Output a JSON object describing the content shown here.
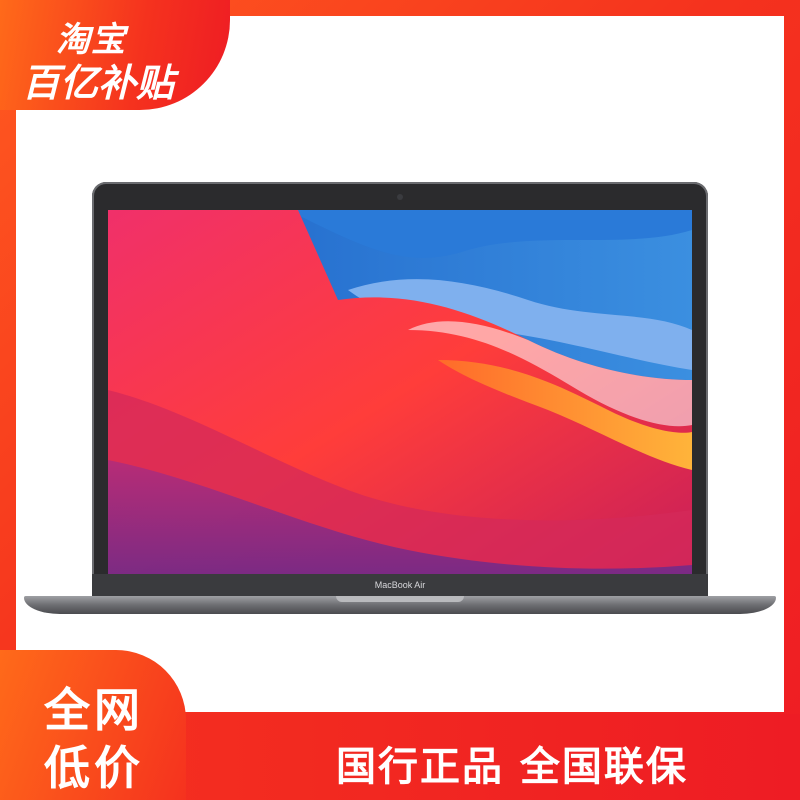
{
  "promo": {
    "top_badge_line1": "淘宝",
    "top_badge_line2": "百亿补贴",
    "bottom_badge_line1": "全网",
    "bottom_badge_line2": "低价",
    "tagline": "国行正品 全国联保"
  },
  "product": {
    "laptop_label": "MacBook Air"
  },
  "colors": {
    "brand_orange": "#ff6a1a",
    "brand_red": "#ee1c24"
  }
}
